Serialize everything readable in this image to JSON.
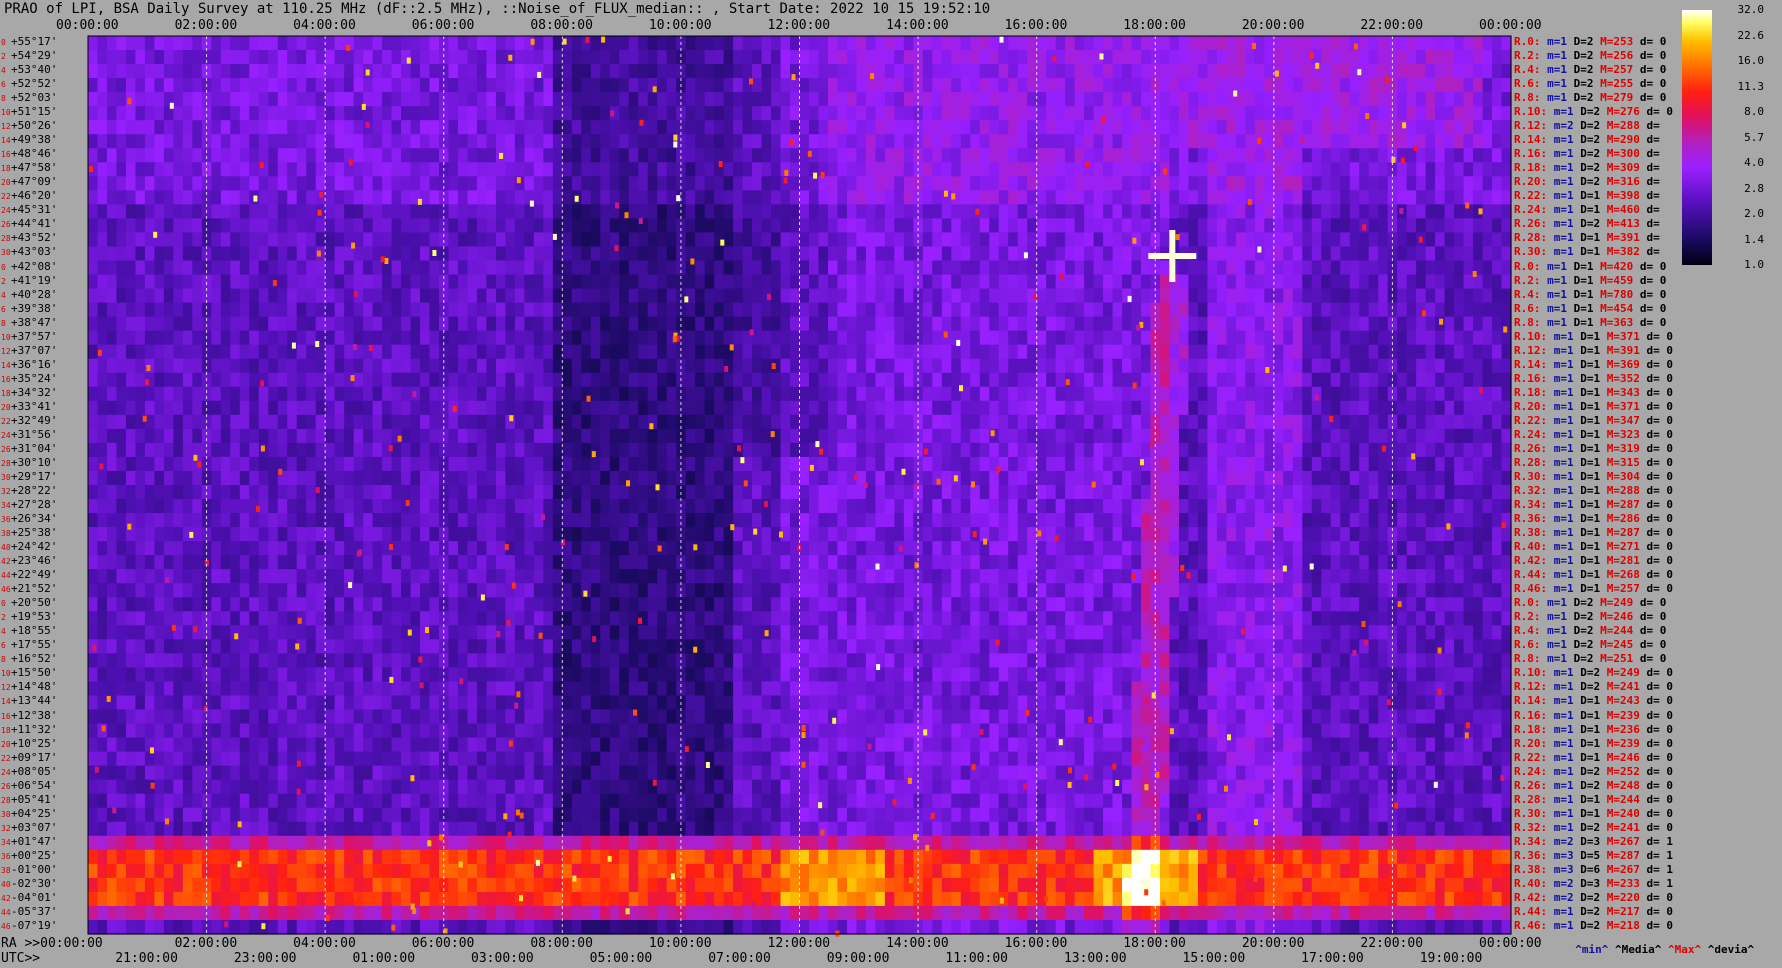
{
  "title": "PRAO of LPI, BSA Daily Survey at 110.25 MHz (dF::2.5 MHz), ::Noise_of_FLUX_median:: , Start Date: 2022 10 15 19:52:10",
  "top_ticks": [
    "00:00:00",
    "02:00:00",
    "04:00:00",
    "06:00:00",
    "08:00:00",
    "10:00:00",
    "12:00:00",
    "14:00:00",
    "16:00:00",
    "18:00:00",
    "20:00:00",
    "22:00:00",
    "00:00:00"
  ],
  "ra_label": "RA >>00:00:00",
  "ra_ticks": [
    "02:00:00",
    "04:00:00",
    "06:00:00",
    "08:00:00",
    "10:00:00",
    "12:00:00",
    "14:00:00",
    "16:00:00",
    "18:00:00",
    "20:00:00",
    "22:00:00",
    "00:00:00"
  ],
  "utc_label": "UTC>>",
  "utc_ticks": [
    "21:00:00",
    "23:00:00",
    "01:00:00",
    "03:00:00",
    "05:00:00",
    "07:00:00",
    "09:00:00",
    "11:00:00",
    "13:00:00",
    "15:00:00",
    "17:00:00",
    "19:00:00"
  ],
  "dec_labels": [
    "+55°17'",
    "+54°29'",
    "+53°40'",
    "+52°52'",
    "+52°03'",
    "+51°15'",
    "+50°26'",
    "+49°38'",
    "+48°46'",
    "+47°58'",
    "+47°09'",
    "+46°20'",
    "+45°31'",
    "+44°41'",
    "+43°52'",
    "+43°03'",
    "+42°08'",
    "+41°19'",
    "+40°28'",
    "+39°38'",
    "+38°47'",
    "+37°57'",
    "+37°07'",
    "+36°16'",
    "+35°24'",
    "+34°32'",
    "+33°41'",
    "+32°49'",
    "+31°56'",
    "+31°04'",
    "+30°10'",
    "+29°17'",
    "+28°22'",
    "+27°28'",
    "+26°34'",
    "+25°38'",
    "+24°42'",
    "+23°46'",
    "+22°49'",
    "+21°52'",
    "+20°50'",
    "+19°53'",
    "+18°55'",
    "+17°55'",
    "+16°52'",
    "+15°50'",
    "+14°48'",
    "+13°44'",
    "+12°38'",
    "+11°32'",
    "+10°25'",
    "+09°17'",
    "+08°05'",
    "+06°54'",
    "+05°41'",
    "+04°25'",
    "+03°07'",
    "+01°47'",
    "+00°25'",
    "-01°00'",
    "-02°30'",
    "-04°01'",
    "-05°37'",
    "-07°19'"
  ],
  "beam_numbers": [
    "0",
    "2",
    "4",
    "6",
    "8",
    "10",
    "12",
    "14",
    "16",
    "18",
    "20",
    "22",
    "24",
    "26",
    "28",
    "30",
    "0",
    "2",
    "4",
    "6",
    "8",
    "10",
    "12",
    "14",
    "16",
    "18",
    "20",
    "22",
    "24",
    "26",
    "28",
    "30",
    "32",
    "34",
    "36",
    "38",
    "40",
    "42",
    "44",
    "46",
    "0",
    "2",
    "4",
    "6",
    "8",
    "10",
    "12",
    "14",
    "16",
    "18",
    "20",
    "22",
    "24",
    "26",
    "28",
    "30",
    "32",
    "34",
    "36",
    "38",
    "40",
    "42",
    "44",
    "46"
  ],
  "right_rows": [
    [
      "R.0:",
      "m=1",
      "D=2",
      "M=253",
      "d= 0"
    ],
    [
      "R.2:",
      "m=1",
      "D=2",
      "M=256",
      "d= 0"
    ],
    [
      "R.4:",
      "m=1",
      "D=2",
      "M=257",
      "d= 0"
    ],
    [
      "R.6:",
      "m=1",
      "D=2",
      "M=255",
      "d= 0"
    ],
    [
      "R.8:",
      "m=1",
      "D=2",
      "M=279",
      "d= 0"
    ],
    [
      "R.10:",
      "m=1",
      "D=2",
      "M=276",
      "d= 0"
    ],
    [
      "R.12:",
      "m=2",
      "D=2",
      "M=288",
      "d= "
    ],
    [
      "R.14:",
      "m=1",
      "D=2",
      "M=290",
      "d= "
    ],
    [
      "R.16:",
      "m=1",
      "D=2",
      "M=300",
      "d= "
    ],
    [
      "R.18:",
      "m=1",
      "D=2",
      "M=309",
      "d= "
    ],
    [
      "R.20:",
      "m=1",
      "D=2",
      "M=316",
      "d= "
    ],
    [
      "R.22:",
      "m=1",
      "D=1",
      "M=398",
      "d= "
    ],
    [
      "R.24:",
      "m=1",
      "D=1",
      "M=460",
      "d= "
    ],
    [
      "R.26:",
      "m=1",
      "D=2",
      "M=413",
      "d= "
    ],
    [
      "R.28:",
      "m=1",
      "D=1",
      "M=391",
      "d= "
    ],
    [
      "R.30:",
      "m=1",
      "D=1",
      "M=382",
      "d= "
    ],
    [
      "R.0:",
      "m=1",
      "D=1",
      "M=420",
      "d= 0"
    ],
    [
      "R.2:",
      "m=1",
      "D=1",
      "M=459",
      "d= 0"
    ],
    [
      "R.4:",
      "m=1",
      "D=1",
      "M=780",
      "d= 0"
    ],
    [
      "R.6:",
      "m=1",
      "D=1",
      "M=454",
      "d= 0"
    ],
    [
      "R.8:",
      "m=1",
      "D=1",
      "M=363",
      "d= 0"
    ],
    [
      "R.10:",
      "m=1",
      "D=1",
      "M=371",
      "d= 0"
    ],
    [
      "R.12:",
      "m=1",
      "D=1",
      "M=391",
      "d= 0"
    ],
    [
      "R.14:",
      "m=1",
      "D=1",
      "M=369",
      "d= 0"
    ],
    [
      "R.16:",
      "m=1",
      "D=1",
      "M=352",
      "d= 0"
    ],
    [
      "R.18:",
      "m=1",
      "D=1",
      "M=343",
      "d= 0"
    ],
    [
      "R.20:",
      "m=1",
      "D=1",
      "M=371",
      "d= 0"
    ],
    [
      "R.22:",
      "m=1",
      "D=1",
      "M=347",
      "d= 0"
    ],
    [
      "R.24:",
      "m=1",
      "D=1",
      "M=323",
      "d= 0"
    ],
    [
      "R.26:",
      "m=1",
      "D=1",
      "M=319",
      "d= 0"
    ],
    [
      "R.28:",
      "m=1",
      "D=1",
      "M=315",
      "d= 0"
    ],
    [
      "R.30:",
      "m=1",
      "D=1",
      "M=304",
      "d= 0"
    ],
    [
      "R.32:",
      "m=1",
      "D=1",
      "M=288",
      "d= 0"
    ],
    [
      "R.34:",
      "m=1",
      "D=1",
      "M=287",
      "d= 0"
    ],
    [
      "R.36:",
      "m=1",
      "D=1",
      "M=286",
      "d= 0"
    ],
    [
      "R.38:",
      "m=1",
      "D=1",
      "M=287",
      "d= 0"
    ],
    [
      "R.40:",
      "m=1",
      "D=1",
      "M=271",
      "d= 0"
    ],
    [
      "R.42:",
      "m=1",
      "D=1",
      "M=281",
      "d= 0"
    ],
    [
      "R.44:",
      "m=1",
      "D=1",
      "M=268",
      "d= 0"
    ],
    [
      "R.46:",
      "m=1",
      "D=1",
      "M=257",
      "d= 0"
    ],
    [
      "R.0:",
      "m=1",
      "D=2",
      "M=249",
      "d= 0"
    ],
    [
      "R.2:",
      "m=1",
      "D=2",
      "M=246",
      "d= 0"
    ],
    [
      "R.4:",
      "m=1",
      "D=2",
      "M=244",
      "d= 0"
    ],
    [
      "R.6:",
      "m=1",
      "D=2",
      "M=245",
      "d= 0"
    ],
    [
      "R.8:",
      "m=1",
      "D=2",
      "M=251",
      "d= 0"
    ],
    [
      "R.10:",
      "m=1",
      "D=2",
      "M=249",
      "d= 0"
    ],
    [
      "R.12:",
      "m=1",
      "D=2",
      "M=241",
      "d= 0"
    ],
    [
      "R.14:",
      "m=1",
      "D=1",
      "M=243",
      "d= 0"
    ],
    [
      "R.16:",
      "m=1",
      "D=1",
      "M=239",
      "d= 0"
    ],
    [
      "R.18:",
      "m=1",
      "D=1",
      "M=236",
      "d= 0"
    ],
    [
      "R.20:",
      "m=1",
      "D=1",
      "M=239",
      "d= 0"
    ],
    [
      "R.22:",
      "m=1",
      "D=1",
      "M=246",
      "d= 0"
    ],
    [
      "R.24:",
      "m=1",
      "D=2",
      "M=252",
      "d= 0"
    ],
    [
      "R.26:",
      "m=1",
      "D=2",
      "M=248",
      "d= 0"
    ],
    [
      "R.28:",
      "m=1",
      "D=1",
      "M=244",
      "d= 0"
    ],
    [
      "R.30:",
      "m=1",
      "D=1",
      "M=240",
      "d= 0"
    ],
    [
      "R.32:",
      "m=1",
      "D=2",
      "M=241",
      "d= 0"
    ],
    [
      "R.34:",
      "m=2",
      "D=3",
      "M=267",
      "d= 1"
    ],
    [
      "R.36:",
      "m=3",
      "D=5",
      "M=287",
      "d= 1"
    ],
    [
      "R.38:",
      "m=3",
      "D=6",
      "M=267",
      "d= 1"
    ],
    [
      "R.40:",
      "m=2",
      "D=3",
      "M=233",
      "d= 1"
    ],
    [
      "R.42:",
      "m=2",
      "D=2",
      "M=220",
      "d= 0"
    ],
    [
      "R.44:",
      "m=1",
      "D=2",
      "M=217",
      "d= 0"
    ],
    [
      "R.46:",
      "m=1",
      "D=2",
      "M=218",
      "d= 0"
    ]
  ],
  "colorbar_labels": [
    "32.0",
    "22.6",
    "16.0",
    "11.3",
    "8.0",
    "5.7",
    "4.0",
    "2.8",
    "2.0",
    "1.4",
    "1.0"
  ],
  "legend": {
    "min": "^min^",
    "media": "^Media^",
    "max": "^Max^",
    "devia": "^devia^"
  },
  "colors": {
    "min": "#1010a0",
    "max": "#e00000"
  },
  "chart_data": {
    "type": "heatmap",
    "title": "PRAO of LPI, BSA Daily Survey at 110.25 MHz (dF::2.5 MHz), ::Noise_of_FLUX_median:: , Start Date: 2022 10 15 19:52:10",
    "x_axis": "RA 00:00:00 to 24:00:00 (UTC 19:52 to 19:52)",
    "y_axis": "Declination +55°17' to -07°19' (64 beams)",
    "color_scale": "log, 1.0 to 32.0",
    "features": [
      {
        "name": "galactic-plane band",
        "dec_rows": [
          58,
          61
        ],
        "level": "high (8-32)"
      },
      {
        "name": "bright source",
        "ra": "20:00:00",
        "dec": "+41°19'",
        "level": "32"
      },
      {
        "name": "drifting band",
        "ra_start": "18:30:00",
        "ra_end": "20:30:00",
        "level": "4-16"
      }
    ]
  }
}
